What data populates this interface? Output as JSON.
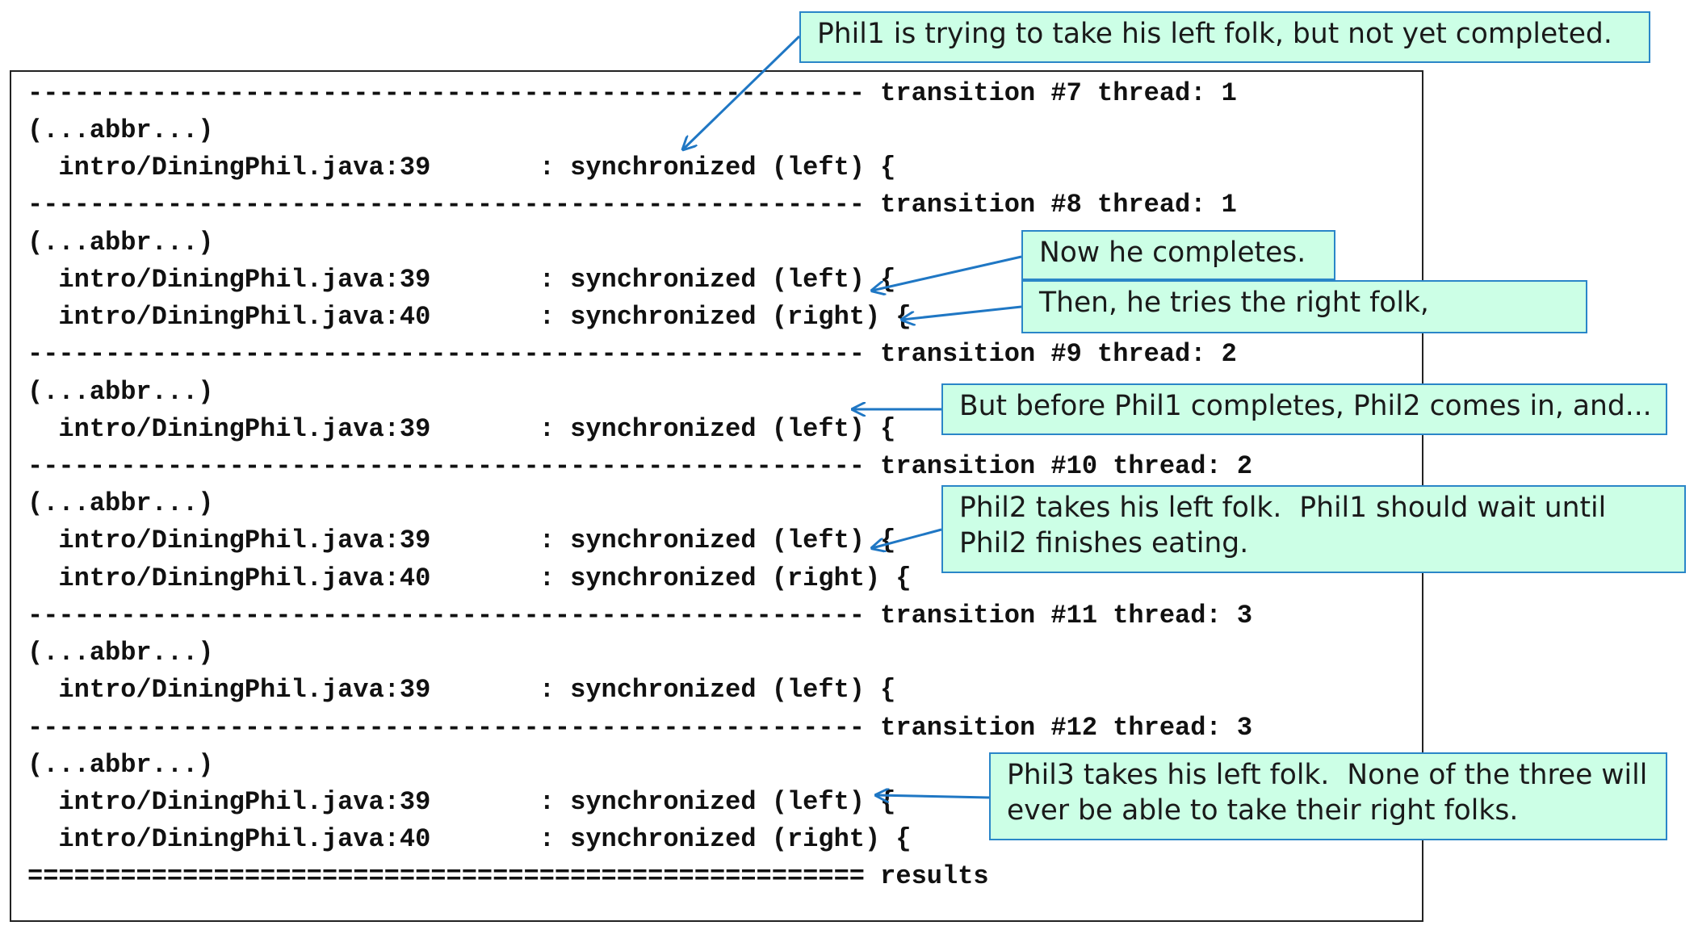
{
  "trace": {
    "lines": [
      "------------------------------------------------------ transition #7 thread: 1",
      "(...abbr...)",
      "  intro/DiningPhil.java:39       : synchronized (left) {",
      "------------------------------------------------------ transition #8 thread: 1",
      "(...abbr...)",
      "  intro/DiningPhil.java:39       : synchronized (left) {",
      "  intro/DiningPhil.java:40       : synchronized (right) {",
      "------------------------------------------------------ transition #9 thread: 2",
      "(...abbr...)",
      "  intro/DiningPhil.java:39       : synchronized (left) {",
      "------------------------------------------------------ transition #10 thread: 2",
      "(...abbr...)",
      "  intro/DiningPhil.java:39       : synchronized (left) {",
      "  intro/DiningPhil.java:40       : synchronized (right) {",
      "------------------------------------------------------ transition #11 thread: 3",
      "(...abbr...)",
      "  intro/DiningPhil.java:39       : synchronized (left) {",
      "------------------------------------------------------ transition #12 thread: 3",
      "(...abbr...)",
      "  intro/DiningPhil.java:39       : synchronized (left) {",
      "  intro/DiningPhil.java:40       : synchronized (right) {",
      "====================================================== results"
    ]
  },
  "callouts": {
    "c1": "Phil1 is trying to take his left folk, but not yet completed.",
    "c2": "Now he completes.",
    "c3": "Then, he tries the right folk,",
    "c4": "But before Phil1 completes, Phil2 comes in, and...",
    "c5": "Phil2 takes his left folk.  Phil1 should wait until\nPhil2 finishes eating.",
    "c6": "Phil3 takes his left folk.  None of the three will\never be able to take their right folks."
  },
  "colors": {
    "callout_fill": "#ccffe6",
    "callout_border": "#2a86c8",
    "arrow": "#1f77c4",
    "code_text": "#111111"
  }
}
